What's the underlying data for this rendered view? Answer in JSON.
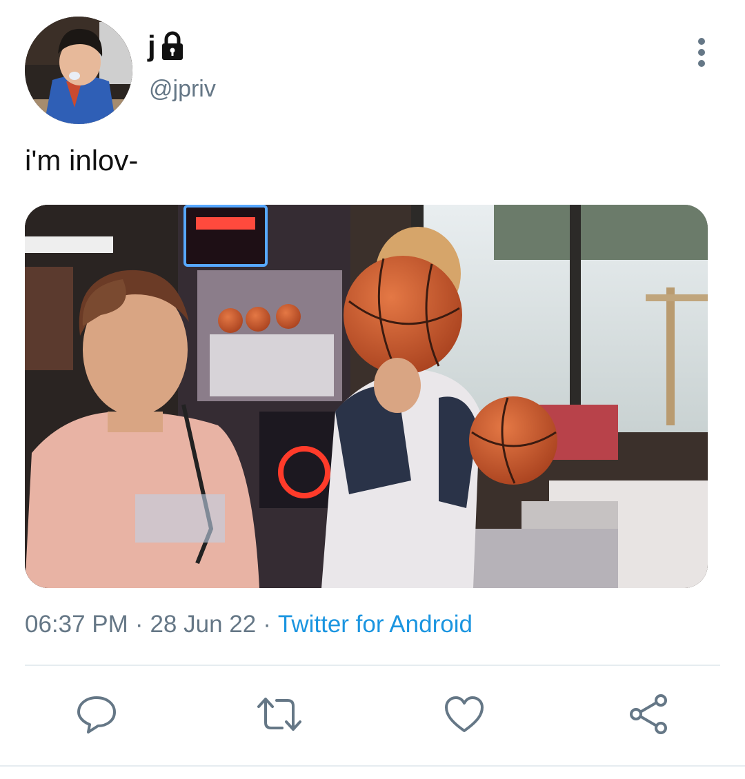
{
  "tweet": {
    "display_name": "j",
    "handle": "@jpriv",
    "text": "i'm inlov-",
    "time": "06:37 PM",
    "date": "28 Jun 22",
    "separator": "·",
    "source": "Twitter for Android",
    "protected_icon": "lock-icon",
    "avatar_icon": "profile-photo",
    "media_icon": "attached-photo"
  },
  "actions": [
    {
      "name": "reply",
      "icon": "speech-bubble-icon"
    },
    {
      "name": "retweet",
      "icon": "retweet-arrows-icon"
    },
    {
      "name": "like",
      "icon": "heart-icon"
    },
    {
      "name": "share",
      "icon": "share-nodes-icon"
    }
  ],
  "colors": {
    "text": "#0f1419",
    "secondary": "#657786",
    "link": "#1b95e0",
    "divider": "#e6ecf0"
  }
}
